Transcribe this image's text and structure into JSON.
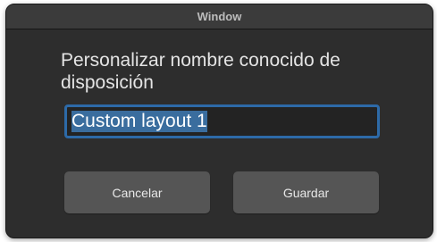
{
  "window": {
    "title": "Window"
  },
  "dialog": {
    "heading": "Personalizar nombre conocido de disposición",
    "input_value": "Custom layout 1",
    "cancel_label": "Cancelar",
    "save_label": "Guardar"
  },
  "colors": {
    "window_bg": "#2d2d2d",
    "titlebar_bg": "#3b3b3b",
    "focus_ring": "#2d6aa8",
    "selection": "#3a6d9e",
    "button_bg": "#555555"
  }
}
